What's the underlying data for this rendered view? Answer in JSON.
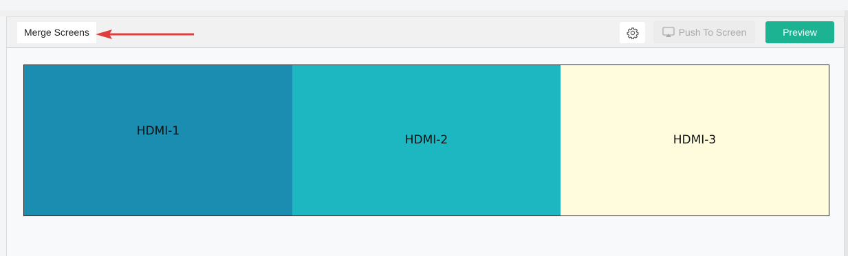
{
  "toolbar": {
    "mode_label": "Merge Screens",
    "push_label": "Push To Screen",
    "preview_label": "Preview",
    "icons": {
      "settings": "gear-icon",
      "push": "cast-screen-icon"
    }
  },
  "annotation": {
    "arrow_color": "#e03c3c"
  },
  "screens": [
    {
      "label": "HDMI-1",
      "color": "#1b8db0"
    },
    {
      "label": "HDMI-2",
      "color": "#1cb7c1"
    },
    {
      "label": "HDMI-3",
      "color": "#fefcdc"
    }
  ],
  "colors": {
    "accent": "#1bb392"
  }
}
